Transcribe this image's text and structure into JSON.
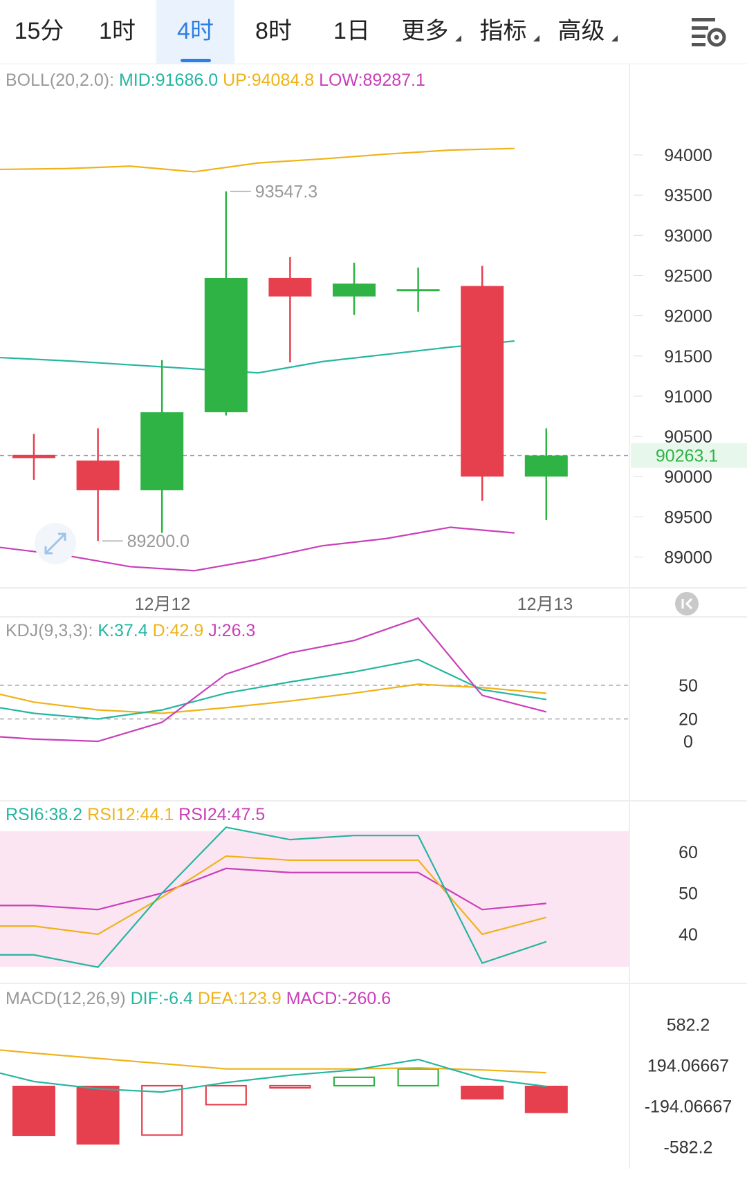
{
  "tabs": [
    {
      "label": "15分",
      "dropdown": false,
      "active": false
    },
    {
      "label": "1时",
      "dropdown": false,
      "active": false
    },
    {
      "label": "4时",
      "dropdown": false,
      "active": true
    },
    {
      "label": "8时",
      "dropdown": false,
      "active": false
    },
    {
      "label": "1日",
      "dropdown": false,
      "active": false
    },
    {
      "label": "更多",
      "dropdown": true,
      "active": false
    },
    {
      "label": "指标",
      "dropdown": true,
      "active": false
    },
    {
      "label": "高级",
      "dropdown": true,
      "active": false
    }
  ],
  "settings_icon": "chart-settings-icon",
  "colors": {
    "up": "#2fb344",
    "down": "#e6404f",
    "mid": "#24b6a0",
    "upper": "#efb319",
    "lower": "#c93fb9",
    "accent": "#2f7fe3",
    "rsi_band": "#fce5f2"
  },
  "chart_data": {
    "type": "candlestick",
    "x_labels": [
      "12月12",
      "12月13"
    ],
    "candles": [
      {
        "o": 90270,
        "h": 90530,
        "l": 89960,
        "c": 90230
      },
      {
        "o": 90200,
        "h": 90600,
        "l": 89200,
        "c": 89830
      },
      {
        "o": 89830,
        "h": 91450,
        "l": 89300,
        "c": 90800
      },
      {
        "o": 90800,
        "h": 93547.3,
        "l": 90760,
        "c": 92470
      },
      {
        "o": 92470,
        "h": 92730,
        "l": 91420,
        "c": 92240
      },
      {
        "o": 92240,
        "h": 92660,
        "l": 92010,
        "c": 92400
      },
      {
        "o": 92330,
        "h": 92600,
        "l": 92050,
        "c": 92330
      },
      {
        "o": 92370,
        "h": 92620,
        "l": 89700,
        "c": 90000
      },
      {
        "o": 90000,
        "h": 90600,
        "l": 89460,
        "c": 90263.1
      }
    ],
    "price_axis": {
      "ticks": [
        94000,
        93500,
        93000,
        92500,
        92000,
        91500,
        91000,
        90500,
        90000,
        89500,
        89000
      ]
    },
    "annotations": {
      "high": "93547.3",
      "low": "89200.0"
    },
    "last_price": "90263.1",
    "boll": {
      "label": "BOLL(20,2.0):",
      "mid_text": "MID:91686.0",
      "up_text": "UP:94084.8",
      "low_text": "LOW:89287.1",
      "mid": [
        91480,
        91440,
        91390,
        91340,
        91290,
        91430,
        91520,
        91610,
        91686
      ],
      "up": [
        93820,
        93830,
        93860,
        93790,
        93900,
        93950,
        94010,
        94060,
        94080
      ],
      "low": [
        89120,
        89020,
        88880,
        88830,
        88970,
        89140,
        89230,
        89370,
        89300
      ]
    },
    "kdj": {
      "label": "KDJ(9,3,3):",
      "k_text": "K:37.4",
      "d_text": "D:42.9",
      "j_text": "J:26.3",
      "ticks": [
        50,
        20,
        0
      ],
      "ref_lines": [
        50,
        20
      ],
      "k": [
        30,
        25,
        20,
        28,
        43,
        53,
        62,
        73,
        46,
        37.4
      ],
      "d": [
        42,
        35,
        28,
        25,
        30,
        36,
        43,
        51,
        48,
        42.9
      ],
      "j": [
        4,
        2,
        0,
        17,
        60,
        79,
        90,
        110,
        41,
        26.3
      ]
    },
    "rsi": {
      "label_6": "RSI6:38.2",
      "label_12": "RSI12:44.1",
      "label_24": "RSI24:47.5",
      "ticks": [
        60,
        50,
        40
      ],
      "rsi6": [
        35,
        35,
        32,
        50,
        66,
        63,
        64,
        64,
        33,
        38.2
      ],
      "rsi12": [
        42,
        42,
        40,
        49,
        59,
        58,
        58,
        58,
        40,
        44.1
      ],
      "rsi24": [
        47,
        47,
        46,
        50,
        56,
        55,
        55,
        55,
        46,
        47.5
      ]
    },
    "macd": {
      "label": "MACD(12,26,9)",
      "dif_text": "DIF:-6.4",
      "dea_text": "DEA:123.9",
      "macd_text": "MACD:-260.6",
      "ticks": [
        "582.2",
        "194.06667",
        "-194.06667",
        "-582.2"
      ],
      "hist": [
        -480,
        -560,
        -470,
        -180,
        -20,
        80,
        160,
        -130,
        -260.6
      ],
      "dif": [
        120,
        40,
        -30,
        -60,
        30,
        100,
        150,
        250,
        70,
        -6.4
      ],
      "dea": [
        340,
        310,
        260,
        210,
        160,
        160,
        160,
        170,
        150,
        123.9
      ]
    }
  }
}
